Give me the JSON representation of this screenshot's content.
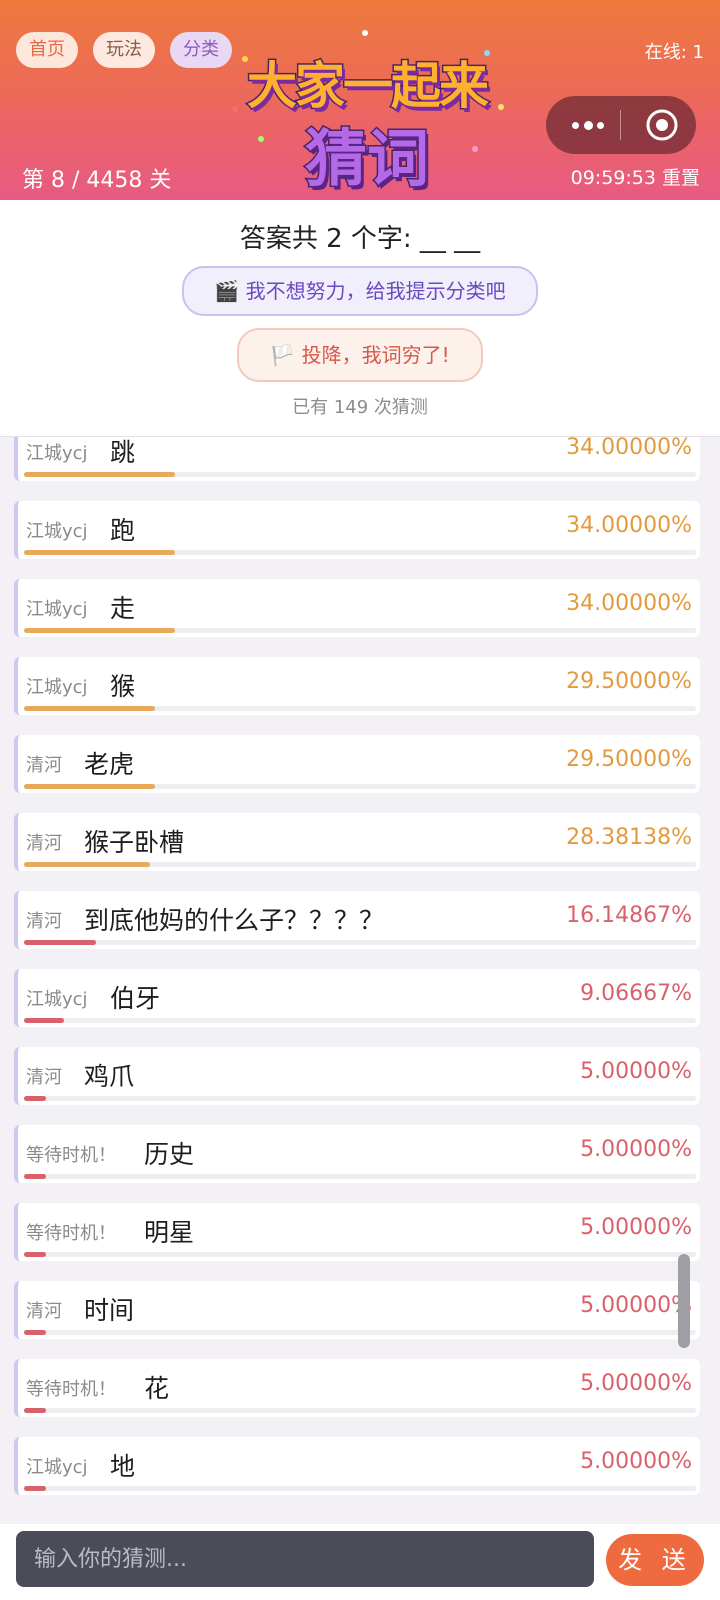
{
  "header": {
    "nav": [
      "首页",
      "玩法",
      "分类"
    ],
    "online": "在线: 1",
    "level": "第 8 / 4458 关",
    "timer": "09:59:53 重置",
    "logo_line1": "大家一起来",
    "logo_line2": "猜词"
  },
  "panel": {
    "answer_length": "答案共 2 个字: __ __",
    "hint_button": "🎬 我不想努力，给我提示分类吧",
    "surrender_button": "🏳️ 投降，我词穷了!",
    "guess_count": "已有 149 次猜测"
  },
  "guesses": [
    {
      "user": "江城ycj",
      "word": "跳",
      "percent": "34.00000%",
      "level": 34.0,
      "tone": "orange"
    },
    {
      "user": "江城ycj",
      "word": "跑",
      "percent": "34.00000%",
      "level": 34.0,
      "tone": "orange"
    },
    {
      "user": "江城ycj",
      "word": "走",
      "percent": "34.00000%",
      "level": 34.0,
      "tone": "orange"
    },
    {
      "user": "江城ycj",
      "word": "猴",
      "percent": "29.50000%",
      "level": 29.5,
      "tone": "orange"
    },
    {
      "user": "清河",
      "word": "老虎",
      "percent": "29.50000%",
      "level": 29.5,
      "tone": "orange"
    },
    {
      "user": "清河",
      "word": "猴子卧槽",
      "percent": "28.38138%",
      "level": 28.38138,
      "tone": "orange"
    },
    {
      "user": "清河",
      "word": "到底他妈的什么子？？？？",
      "percent": "16.14867%",
      "level": 16.14867,
      "tone": "red"
    },
    {
      "user": "江城ycj",
      "word": "伯牙",
      "percent": "9.06667%",
      "level": 9.06667,
      "tone": "red"
    },
    {
      "user": "清河",
      "word": "鸡爪",
      "percent": "5.00000%",
      "level": 5.0,
      "tone": "red"
    },
    {
      "user": "等待时机！",
      "word": "历史",
      "percent": "5.00000%",
      "level": 5.0,
      "tone": "red"
    },
    {
      "user": "等待时机！",
      "word": "明星",
      "percent": "5.00000%",
      "level": 5.0,
      "tone": "red"
    },
    {
      "user": "清河",
      "word": "时间",
      "percent": "5.00000%",
      "level": 5.0,
      "tone": "red"
    },
    {
      "user": "等待时机！",
      "word": "花",
      "percent": "5.00000%",
      "level": 5.0,
      "tone": "red"
    },
    {
      "user": "江城ycj",
      "word": "地",
      "percent": "5.00000%",
      "level": 5.0,
      "tone": "red"
    }
  ],
  "input": {
    "placeholder": "输入你的猜测..."
  },
  "send_label": "发 送",
  "colors": {
    "orange": "#e9a95a",
    "red": "#d9616b",
    "send": "#ef6b3f"
  }
}
